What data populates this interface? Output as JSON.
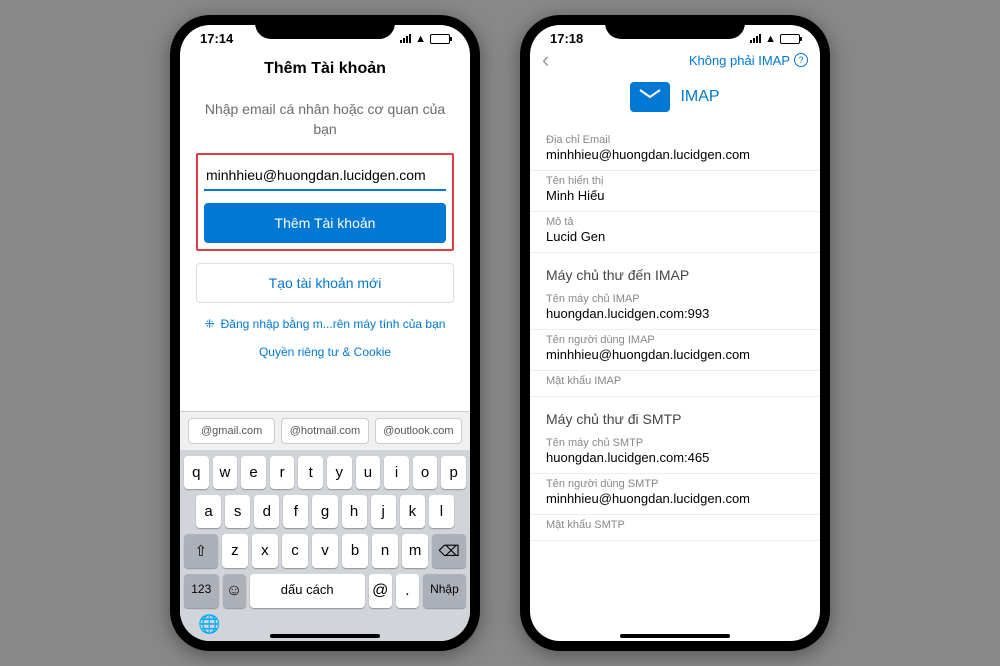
{
  "screen1": {
    "time": "17:14",
    "title": "Thêm Tài khoản",
    "prompt": "Nhập email cá nhân hoặc cơ quan của bạn",
    "email_value": "minhhieu@huongdan.lucidgen.com",
    "add_button": "Thêm Tài khoản",
    "create_button": "Tạo tài khoản mới",
    "qr_login": "Đăng nhập bằng m...rên máy tính của bạn",
    "privacy": "Quyền riêng tư & Cookie",
    "suggestions": [
      "@gmail.com",
      "@hotmail.com",
      "@outlook.com"
    ],
    "keyboard": {
      "row1": [
        "q",
        "w",
        "e",
        "r",
        "t",
        "y",
        "u",
        "i",
        "o",
        "p"
      ],
      "row2": [
        "a",
        "s",
        "d",
        "f",
        "g",
        "h",
        "j",
        "k",
        "l"
      ],
      "row3": [
        "z",
        "x",
        "c",
        "v",
        "b",
        "n",
        "m"
      ],
      "space": "dấu cách",
      "enter": "Nhập",
      "numbers": "123",
      "at": "@",
      "dot": "."
    }
  },
  "screen2": {
    "time": "17:18",
    "not_imap": "Không phải IMAP",
    "imap_title": "IMAP",
    "fields": {
      "email_label": "Địa chỉ Email",
      "email_value": "minhhieu@huongdan.lucidgen.com",
      "display_label": "Tên hiển thị",
      "display_value": "Minh Hiếu",
      "desc_label": "Mô tả",
      "desc_value": "Lucid Gen"
    },
    "imap_section": "Máy chủ thư đến IMAP",
    "imap": {
      "host_label": "Tên máy chủ IMAP",
      "host_value": "huongdan.lucidgen.com:993",
      "user_label": "Tên người dùng IMAP",
      "user_value": "minhhieu@huongdan.lucidgen.com",
      "pass_label": "Mật khẩu IMAP"
    },
    "smtp_section": "Máy chủ thư đi SMTP",
    "smtp": {
      "host_label": "Tên máy chủ SMTP",
      "host_value": "huongdan.lucidgen.com:465",
      "user_label": "Tên người dùng SMTP",
      "user_value": "minhhieu@huongdan.lucidgen.com",
      "pass_label": "Mật khẩu SMTP"
    }
  }
}
